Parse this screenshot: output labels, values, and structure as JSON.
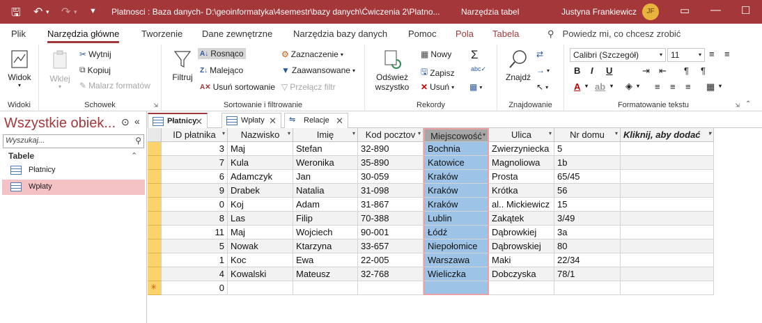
{
  "titlebar": {
    "title": "Platnosci : Baza danych- D:\\geoinformatyka\\4semestr\\bazy danych\\Ćwiczenia 2\\Platno...",
    "context": "Narzędzia tabel",
    "user": "Justyna Frankiewicz",
    "initials": "JF"
  },
  "tabs": [
    "Plik",
    "Narzędzia główne",
    "Tworzenie",
    "Dane zewnętrzne",
    "Narzędzia bazy danych",
    "Pomoc",
    "Pola",
    "Tabela"
  ],
  "tell_me": "Powiedz mi, co chcesz zrobić",
  "ribbon": {
    "widoki": {
      "label": "Widoki",
      "widok": "Widok"
    },
    "schowek": {
      "label": "Schowek",
      "wklej": "Wklej",
      "wytnij": "Wytnij",
      "kopiuj": "Kopiuj",
      "malarz": "Malarz formatów"
    },
    "sort": {
      "label": "Sortowanie i filtrowanie",
      "filtruj": "Filtruj",
      "rosnaco": "Rosnąco",
      "malejaco": "Malejąco",
      "usun_sort": "Usuń sortowanie",
      "zaznaczenie": "Zaznaczenie",
      "zaawansowane": "Zaawansowane",
      "przelacz": "Przełącz filtr"
    },
    "rekordy": {
      "label": "Rekordy",
      "odswiez_1": "Odśwież",
      "odswiez_2": "wszystko",
      "nowy": "Nowy",
      "zapisz": "Zapisz",
      "usun": "Usuń"
    },
    "znajdowanie": {
      "label": "Znajdowanie",
      "znajdz": "Znajdź"
    },
    "tekst": {
      "label": "Formatowanie tekstu",
      "font": "Calibri (Szczegół)",
      "size": "11"
    }
  },
  "nav": {
    "header": "Wszystkie obiek...",
    "search_placeholder": "Wyszukaj...",
    "section": "Tabele",
    "items": [
      "Płatnicy",
      "Wpłaty"
    ]
  },
  "doc_tabs": [
    "Płatnicy",
    "Wpłaty",
    "Relacje"
  ],
  "table": {
    "columns": [
      "ID płatnika",
      "Nazwisko",
      "Imię",
      "Kod pocztov",
      "Miejscowość",
      "Ulica",
      "Nr domu",
      "Kliknij, aby dodać"
    ],
    "rows": [
      [
        "3",
        "Maj",
        "Stefan",
        "32-890",
        "Bochnia",
        "Zwierzyniecka",
        "5"
      ],
      [
        "7",
        "Kula",
        "Weronika",
        "35-890",
        "Katowice",
        "Magnoliowa",
        "1b"
      ],
      [
        "6",
        "Adamczyk",
        "Jan",
        "30-059",
        "Kraków",
        "Prosta",
        "65/45"
      ],
      [
        "9",
        "Drabek",
        "Natalia",
        "31-098",
        "Kraków",
        "Krótka",
        "56"
      ],
      [
        "0",
        "Koj",
        "Adam",
        "31-867",
        "Kraków",
        "al.. Mickiewicz",
        "15"
      ],
      [
        "8",
        "Las",
        "Filip",
        "70-388",
        "Lublin",
        "Zakątek",
        "3/49"
      ],
      [
        "11",
        "Maj",
        "Wojciech",
        "90-001",
        "Łódź",
        "Dąbrowkiej",
        "3a"
      ],
      [
        "5",
        "Nowak",
        "Ktarzyna",
        "33-657",
        "Niepołomice",
        "Dąbrowskiej",
        "80"
      ],
      [
        "1",
        "Koc",
        "Ewa",
        "22-005",
        "Warszawa",
        "Maki",
        "22/34"
      ],
      [
        "4",
        "Kowalski",
        "Mateusz",
        "32-768",
        "Wieliczka",
        "Dobczyska",
        "78/1"
      ]
    ],
    "new_row_id": "0"
  }
}
